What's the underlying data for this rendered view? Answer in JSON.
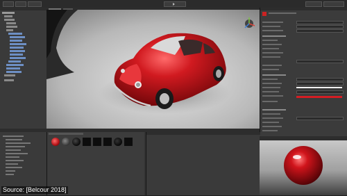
{
  "source_caption": "Source: [Belcour 2018]",
  "colors": {
    "car_red": "#c0131a",
    "accent_red": "#d51d23",
    "viewport_bg": "#8a8a8a",
    "panel_bg": "#3a3a3a"
  },
  "icons": {
    "gizmo": "scene-gizmo-icon",
    "play": "play-icon",
    "material_sphere": "material-sphere-icon"
  }
}
